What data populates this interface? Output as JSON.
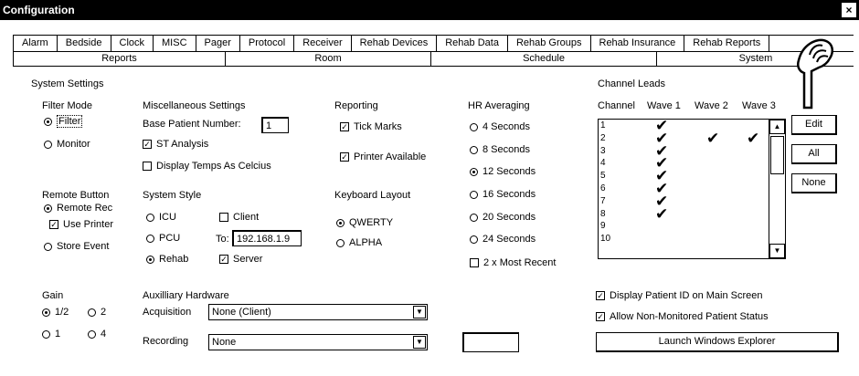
{
  "window": {
    "title": "Configuration",
    "close_label": "×"
  },
  "tabs_row1": [
    "Alarm",
    "Bedside",
    "Clock",
    "MISC",
    "Pager",
    "Protocol",
    "Receiver",
    "Rehab Devices",
    "Rehab Data",
    "Rehab Groups",
    "Rehab Insurance",
    "Rehab Reports"
  ],
  "tabs_row2": [
    "Reports",
    "Room",
    "Schedule",
    "System"
  ],
  "active_tab": "System",
  "system_settings": {
    "label": "System Settings"
  },
  "filter_mode": {
    "label": "Filter Mode",
    "options": [
      "Filter",
      "Monitor"
    ],
    "selected": "Filter"
  },
  "misc": {
    "label": "Miscellaneous Settings",
    "base_patient_label": "Base Patient Number:",
    "base_patient_value": "1",
    "st_analysis": "ST Analysis",
    "st_analysis_checked": true,
    "display_temps": "Display Temps As Celcius",
    "display_temps_checked": false
  },
  "reporting": {
    "label": "Reporting",
    "tick_marks": "Tick Marks",
    "tick_marks_checked": true,
    "printer_available": "Printer Available",
    "printer_available_checked": true
  },
  "hr_averaging": {
    "label": "HR Averaging",
    "options": [
      "4 Seconds",
      "8 Seconds",
      "12 Seconds",
      "16 Seconds",
      "20 Seconds",
      "24 Seconds"
    ],
    "selected": "12 Seconds",
    "most_recent": "2 x Most Recent",
    "most_recent_checked": false
  },
  "channel_leads": {
    "label": "Channel Leads",
    "headers": [
      "Channel",
      "Wave 1",
      "Wave 2",
      "Wave 3"
    ],
    "rows": [
      {
        "ch": "1",
        "w1": true,
        "w2": false,
        "w3": false
      },
      {
        "ch": "2",
        "w1": true,
        "w2": true,
        "w3": true
      },
      {
        "ch": "3",
        "w1": true,
        "w2": false,
        "w3": false
      },
      {
        "ch": "4",
        "w1": true,
        "w2": false,
        "w3": false
      },
      {
        "ch": "5",
        "w1": true,
        "w2": false,
        "w3": false
      },
      {
        "ch": "6",
        "w1": true,
        "w2": false,
        "w3": false
      },
      {
        "ch": "7",
        "w1": true,
        "w2": false,
        "w3": false
      },
      {
        "ch": "8",
        "w1": true,
        "w2": false,
        "w3": false
      },
      {
        "ch": "9",
        "w1": false,
        "w2": false,
        "w3": false
      },
      {
        "ch": "10",
        "w1": false,
        "w2": false,
        "w3": false
      }
    ],
    "tick_glyph": "✔",
    "buttons": [
      "Edit",
      "All",
      "None"
    ]
  },
  "remote_button": {
    "label": "Remote Button",
    "remote_rec": "Remote Rec",
    "use_printer": "Use Printer",
    "use_printer_checked": true,
    "store_event": "Store Event",
    "selected": "Remote Rec"
  },
  "system_style": {
    "label": "System Style",
    "options": [
      "ICU",
      "PCU",
      "Rehab"
    ],
    "selected": "Rehab",
    "client": "Client",
    "client_checked": false,
    "to_label": "To:",
    "to_value": "192.168.1.9",
    "server": "Server",
    "server_checked": true
  },
  "keyboard": {
    "label": "Keyboard Layout",
    "options": [
      "QWERTY",
      "ALPHA"
    ],
    "selected": "QWERTY"
  },
  "gain": {
    "label": "Gain",
    "options": [
      "1/2",
      "2",
      "1",
      "4"
    ],
    "selected": "1/2"
  },
  "aux": {
    "label": "Auxilliary Hardware",
    "acquisition_label": "Acquisition",
    "acquisition_value": "None (Client)",
    "recording_label": "Recording",
    "recording_value": "None"
  },
  "display_patient_id": "Display Patient ID on Main Screen",
  "display_patient_id_checked": true,
  "allow_non_monitored": "Allow Non-Monitored Patient Status",
  "allow_non_monitored_checked": true,
  "launch_explorer": "Launch Windows Explorer"
}
